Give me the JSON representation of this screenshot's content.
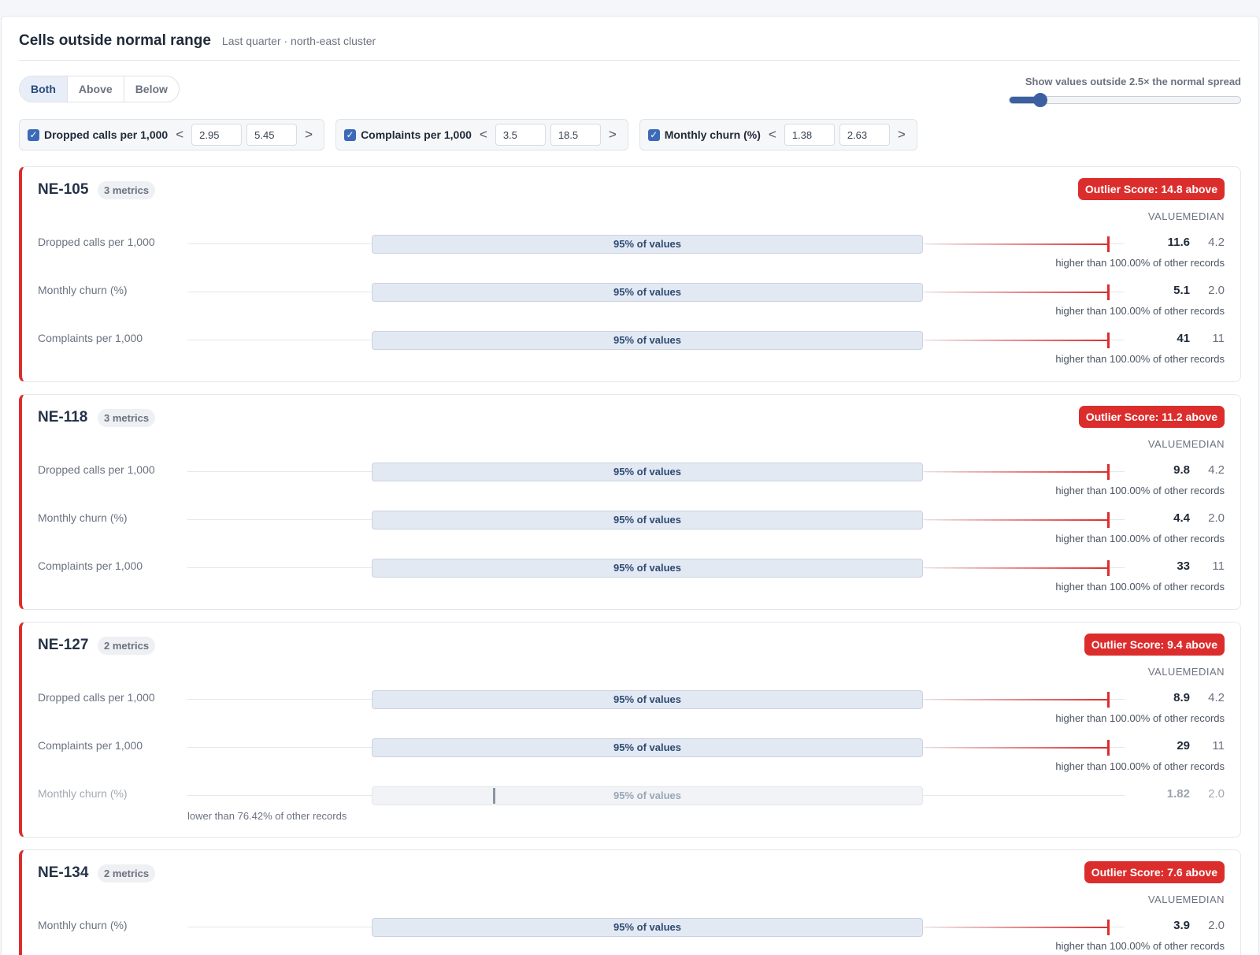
{
  "header": {
    "title": "Cells outside normal range",
    "subtitle": "Last quarter · north-east cluster"
  },
  "direction_toggle": {
    "options": [
      "Both",
      "Above",
      "Below"
    ],
    "selected": "Both"
  },
  "spread_slider": {
    "label": "Show values outside 2.5× the normal spread",
    "level_fraction": 0.14
  },
  "filters": [
    {
      "label": "Dropped calls per 1,000",
      "checked": true,
      "lt_op": "<",
      "low": "2.95",
      "high": "5.45",
      "gt_op": ">"
    },
    {
      "label": "Complaints per 1,000",
      "checked": true,
      "lt_op": "<",
      "low": "3.5",
      "high": "18.5",
      "gt_op": ">"
    },
    {
      "label": "Monthly churn (%)",
      "checked": true,
      "lt_op": "<",
      "low": "1.38",
      "high": "2.63",
      "gt_op": ">"
    }
  ],
  "columns": {
    "value": "VALUE",
    "median": "MEDIAN"
  },
  "band_label": "95% of values",
  "cards": [
    {
      "name": "NE-105",
      "metrics_badge": "3 metrics",
      "score": "Outlier Score: 14.8 above",
      "rows": [
        {
          "label": "Dropped calls per 1,000",
          "value": "11.6",
          "median": "4.2",
          "note": "higher than 100.00% of other records",
          "outlier": true
        },
        {
          "label": "Monthly churn (%)",
          "value": "5.1",
          "median": "2.0",
          "note": "higher than 100.00% of other records",
          "outlier": true
        },
        {
          "label": "Complaints per 1,000",
          "value": "41",
          "median": "11",
          "note": "higher than 100.00% of other records",
          "outlier": true
        }
      ]
    },
    {
      "name": "NE-118",
      "metrics_badge": "3 metrics",
      "score": "Outlier Score: 11.2 above",
      "rows": [
        {
          "label": "Dropped calls per 1,000",
          "value": "9.8",
          "median": "4.2",
          "note": "higher than 100.00% of other records",
          "outlier": true
        },
        {
          "label": "Monthly churn (%)",
          "value": "4.4",
          "median": "2.0",
          "note": "higher than 100.00% of other records",
          "outlier": true
        },
        {
          "label": "Complaints per 1,000",
          "value": "33",
          "median": "11",
          "note": "higher than 100.00% of other records",
          "outlier": true
        }
      ]
    },
    {
      "name": "NE-127",
      "metrics_badge": "2 metrics",
      "score": "Outlier Score: 9.4 above",
      "rows": [
        {
          "label": "Dropped calls per 1,000",
          "value": "8.9",
          "median": "4.2",
          "note": "higher than 100.00% of other records",
          "outlier": true
        },
        {
          "label": "Complaints per 1,000",
          "value": "29",
          "median": "11",
          "note": "higher than 100.00% of other records",
          "outlier": true
        },
        {
          "label": "Monthly churn (%)",
          "value": "1.82",
          "median": "2.0",
          "note": "lower than 76.42% of other records",
          "outlier": false,
          "marker_position": 0.22
        }
      ]
    },
    {
      "name": "NE-134",
      "metrics_badge": "2 metrics",
      "score": "Outlier Score: 7.6 above",
      "rows": [
        {
          "label": "Monthly churn (%)",
          "value": "3.9",
          "median": "2.0",
          "note": "higher than 100.00% of other records",
          "outlier": true
        }
      ]
    }
  ]
}
